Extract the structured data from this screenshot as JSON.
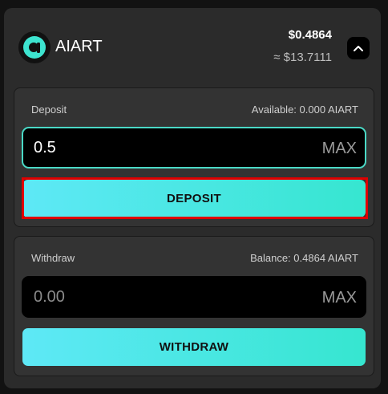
{
  "header": {
    "token_name": "AIART",
    "price_token": "$0.4864",
    "price_usd": "≈ $13.7111",
    "toggle_icon": "chevron-up-icon",
    "logo_icon": "aiart-logo-icon"
  },
  "deposit": {
    "label": "Deposit",
    "available": "Available: 0.000 AIART",
    "input_value": "0.5",
    "max_label": "MAX",
    "button_label": "DEPOSIT"
  },
  "withdraw": {
    "label": "Withdraw",
    "balance": "Balance: 0.4864 AIART",
    "input_placeholder": "0.00",
    "max_label": "MAX",
    "button_label": "WITHDRAW"
  },
  "colors": {
    "accent_start": "#5ee8f6",
    "accent_end": "#36e6d0",
    "focus_border": "#4ad9c6",
    "highlight": "#e00000",
    "card_bg": "#2b2b2b"
  }
}
